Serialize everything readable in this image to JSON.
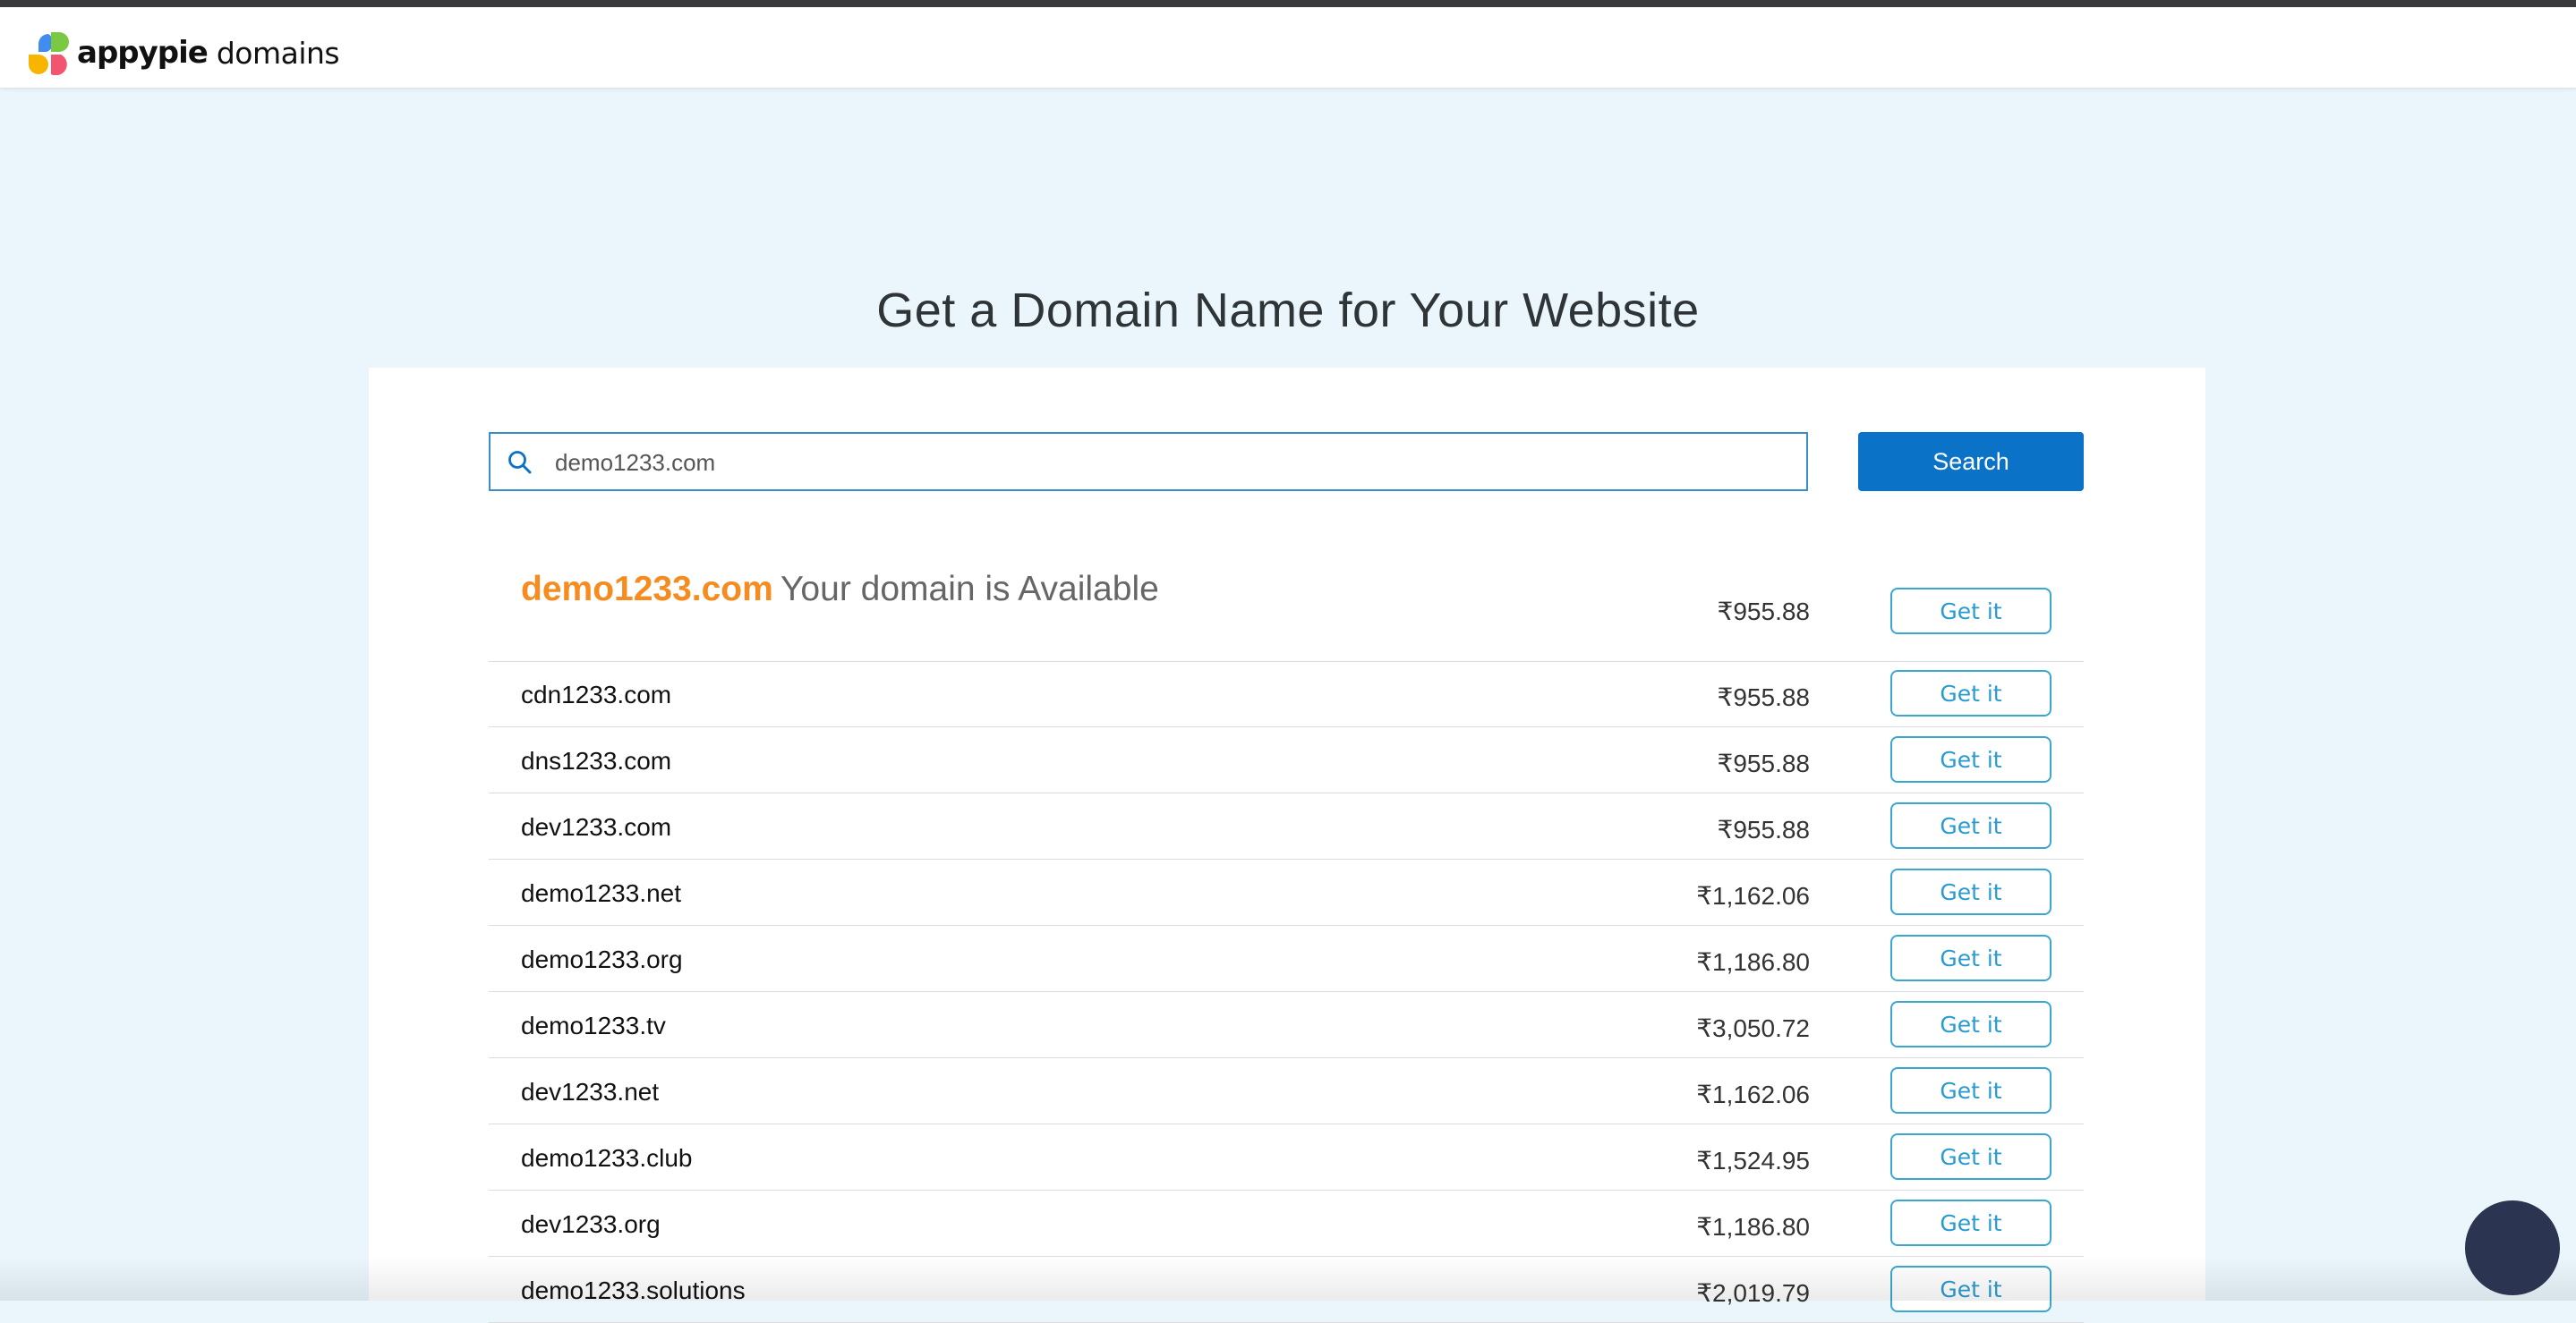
{
  "header": {
    "brand": "appypie",
    "product": "domains"
  },
  "hero": {
    "title": "Get a Domain Name for Your Website"
  },
  "search": {
    "value": "demo1233.com",
    "button_label": "Search",
    "icon": "search-icon"
  },
  "featured": {
    "domain": "demo1233.com",
    "status": "Your domain is Available",
    "price": "₹955.88",
    "button_label": "Get it"
  },
  "results": [
    {
      "domain": "cdn1233.com",
      "price": "₹955.88",
      "button_label": "Get it"
    },
    {
      "domain": "dns1233.com",
      "price": "₹955.88",
      "button_label": "Get it"
    },
    {
      "domain": "dev1233.com",
      "price": "₹955.88",
      "button_label": "Get it"
    },
    {
      "domain": "demo1233.net",
      "price": "₹1,162.06",
      "button_label": "Get it"
    },
    {
      "domain": "demo1233.org",
      "price": "₹1,186.80",
      "button_label": "Get it"
    },
    {
      "domain": "demo1233.tv",
      "price": "₹3,050.72",
      "button_label": "Get it"
    },
    {
      "domain": "dev1233.net",
      "price": "₹1,162.06",
      "button_label": "Get it"
    },
    {
      "domain": "demo1233.club",
      "price": "₹1,524.95",
      "button_label": "Get it"
    },
    {
      "domain": "dev1233.org",
      "price": "₹1,186.80",
      "button_label": "Get it"
    },
    {
      "domain": "demo1233.solutions",
      "price": "₹2,019.79",
      "button_label": "Get it"
    }
  ],
  "colors": {
    "accent_orange": "#f68b1f",
    "primary_blue": "#0a72c7",
    "outline_blue": "#3aa7d0",
    "page_background": "#eaf5fc",
    "chat_bubble": "#2b3450"
  }
}
